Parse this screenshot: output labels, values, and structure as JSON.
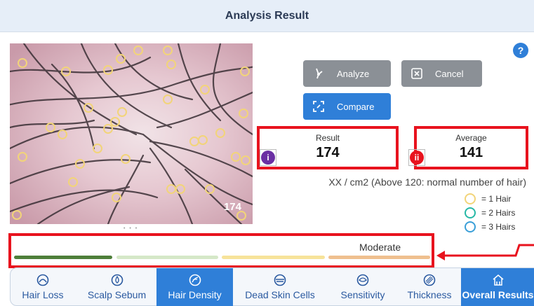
{
  "header": {
    "title": "Analysis Result"
  },
  "help": {
    "label": "?"
  },
  "image": {
    "count_overlay": "174",
    "pager": "• • •"
  },
  "actions": {
    "analyze_label": "Analyze",
    "cancel_label": "Cancel",
    "compare_label": "Compare"
  },
  "result": {
    "label": "Result",
    "value": "174",
    "marker": "i"
  },
  "average": {
    "label": "Average",
    "value": "141",
    "marker": "ii"
  },
  "unit_note": "XX / cm2 (Above 120: normal number of hair)",
  "legend": [
    {
      "label": "= 1 Hair",
      "color": "#f2d479"
    },
    {
      "label": "= 2 Hairs",
      "color": "#26b8a6"
    },
    {
      "label": "= 3 Hairs",
      "color": "#3a9fd8"
    }
  ],
  "density_level": {
    "label": "Moderate"
  },
  "level_colors": [
    "#4e7f3a",
    "#d5e8c8",
    "#f7e39a",
    "#efc08f"
  ],
  "nav": [
    {
      "label": "Hair Loss",
      "icon": "hair-loss-icon"
    },
    {
      "label": "Scalp Sebum",
      "icon": "sebum-icon"
    },
    {
      "label": "Hair Density",
      "icon": "hair-density-icon"
    },
    {
      "label": "Dead Skin Cells",
      "icon": "dead-skin-icon"
    },
    {
      "label": "Sensitivity",
      "icon": "sensitivity-icon"
    },
    {
      "label": "Thickness",
      "icon": "thickness-icon"
    },
    {
      "label": "Overall Results",
      "icon": "overall-results-icon"
    }
  ],
  "colors": {
    "accent": "#2f7fd8",
    "highlight": "#e8131e",
    "button_gray": "#8b9096"
  }
}
